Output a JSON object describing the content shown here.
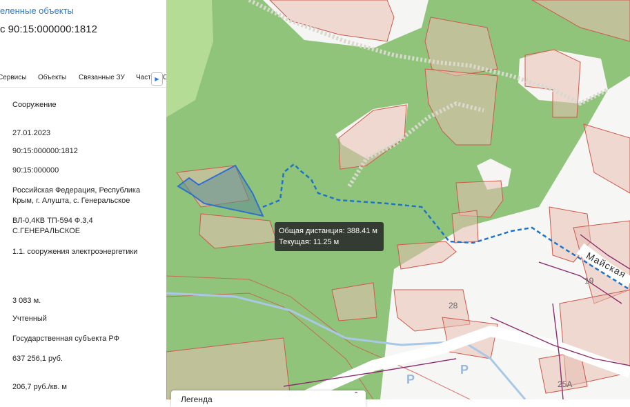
{
  "panel": {
    "header_link": "еленные объекты",
    "title": "с 90:15:000000:1812",
    "tabs": [
      "Сервисы",
      "Объекты",
      "Связанные ЗУ",
      "Часть"
    ],
    "tab_cut": "С",
    "values": [
      "Сооружение",
      "27.01.2023",
      "90:15:000000:1812",
      "90:15:000000",
      "Российская Федерация, Республика Крым, г. Алушта, с. Генеральское",
      "ВЛ-0,4КВ ТП-594 Ф.3,4 С.ГЕНЕРАЛЬСКОЕ",
      "1.1. сооружения электроэнергетики",
      "3 083 м.",
      "Учтенный",
      "Государственная субъекта РФ",
      "637 256,1 руб.",
      "206,7 руб./кв. м"
    ]
  },
  "map": {
    "tooltip_total": "Общая дистанция: 388.41 м",
    "tooltip_current": "Текущая: 11.25 м",
    "street_label": "Майская",
    "house_numbers": [
      "19",
      "28",
      "25А"
    ],
    "parking_labels": [
      "P",
      "P"
    ],
    "legend_label": "Легенда",
    "colors": {
      "forest": "#8fc47a",
      "parcel_border": "#d0574b",
      "measure_line": "#1e74c8",
      "selected": "#2f6fd0"
    }
  }
}
